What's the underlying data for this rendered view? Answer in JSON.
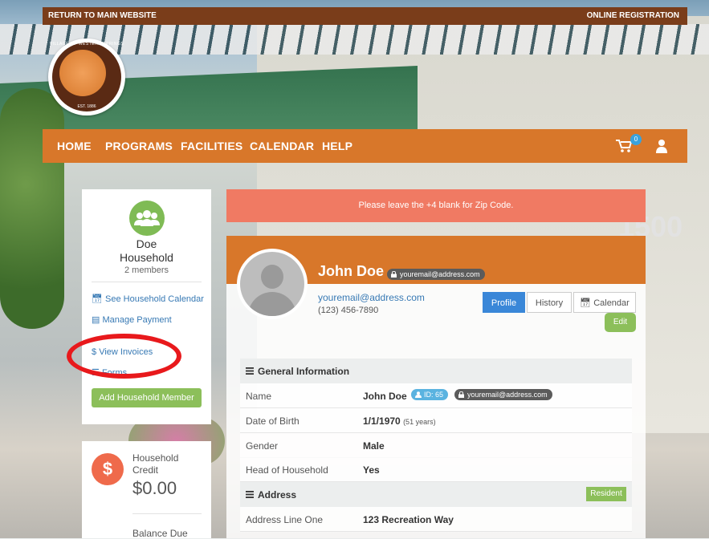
{
  "top_bar": {
    "left_link": "RETURN TO MAIN WEBSITE",
    "right_link": "ONLINE REGISTRATION"
  },
  "logo": {
    "text": "VILLAGE OF WESTERN SPRINGS",
    "est": "EST. 1886"
  },
  "nav": {
    "items": [
      "HOME",
      "PROGRAMS",
      "FACILITIES",
      "CALENDAR",
      "HELP"
    ],
    "cart_count": "0"
  },
  "household": {
    "name_line1": "Doe",
    "name_line2": "Household",
    "members": "2 members",
    "links": [
      "See Household Calendar",
      "Manage Payment",
      "View Invoices",
      "Forms"
    ],
    "add_button": "Add Household Member"
  },
  "credit": {
    "label_line1": "Household",
    "label_line2": "Credit",
    "amount": "$0.00",
    "balance_label": "Balance Due"
  },
  "alert": "Please leave the +4 blank for Zip Code.",
  "profile": {
    "name": "John Doe",
    "email_pill": "youremail@address.com",
    "email": "youremail@address.com",
    "phone": "(123) 456-7890",
    "tabs": [
      "Profile",
      "History",
      "Calendar"
    ],
    "edit": "Edit"
  },
  "general": {
    "title": "General Information",
    "rows": [
      {
        "key": "Name",
        "value": "John Doe",
        "id_badge": "ID: 65",
        "email_badge": "youremail@address.com"
      },
      {
        "key": "Date of Birth",
        "value": "1/1/1970",
        "note": "(51 years)"
      },
      {
        "key": "Gender",
        "value": "Male"
      },
      {
        "key": "Head of Household",
        "value": "Yes"
      }
    ]
  },
  "address": {
    "title": "Address",
    "badge": "Resident",
    "rows": [
      {
        "key": "Address Line One",
        "value": "123 Recreation Way"
      }
    ]
  },
  "background_sign": "1500",
  "colors": {
    "nav": "#d8772a",
    "topbar": "#7a3d1a",
    "alert": "#f07a63",
    "green": "#8cbf5a",
    "blue": "#3a87d8",
    "annotation": "#e8191c"
  }
}
